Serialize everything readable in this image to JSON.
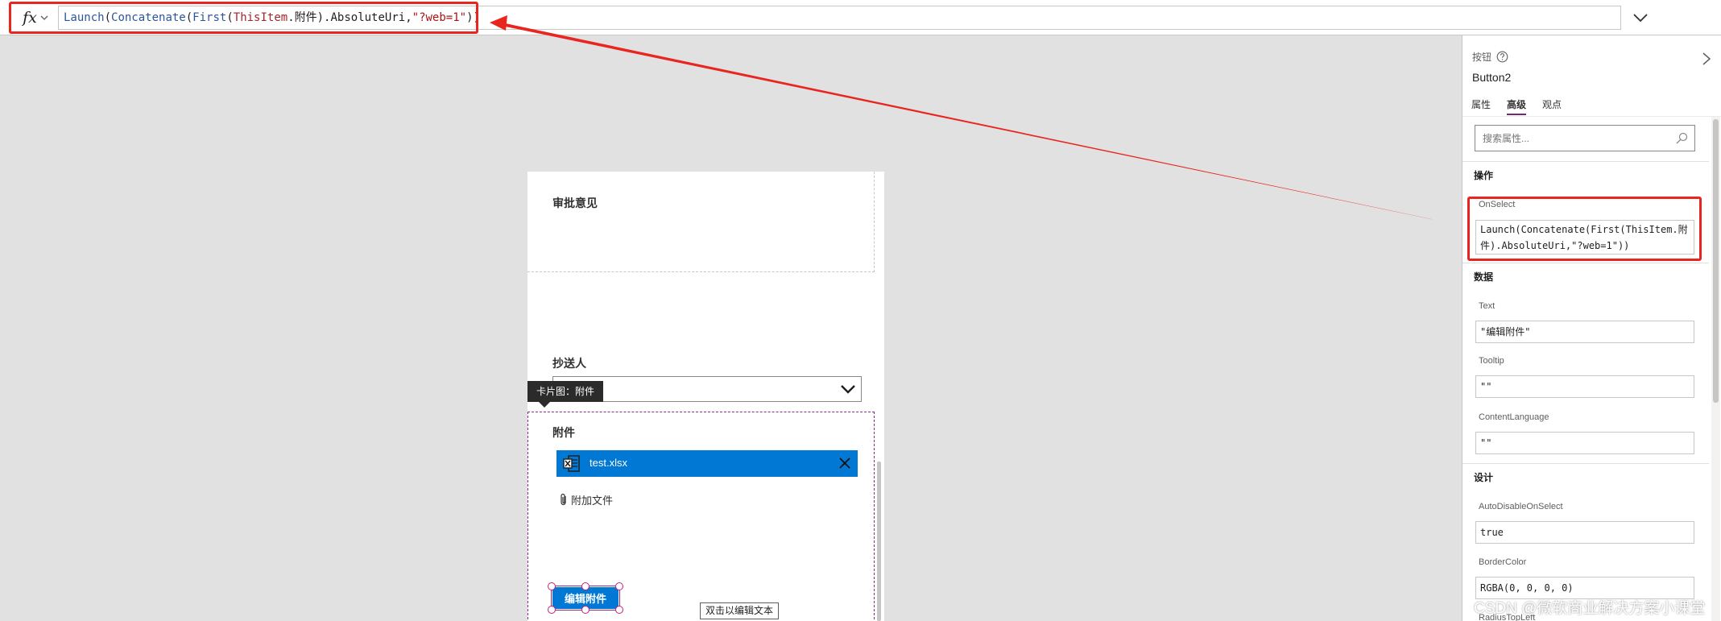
{
  "formula_bar": {
    "fx_label": "fx",
    "formula": {
      "t1": "Launch",
      "t2": "(",
      "t3": "Concatenate",
      "t4": "(",
      "t5": "First",
      "t6": "(",
      "t7": "ThisItem",
      "t8": ".附件).AbsoluteUri,",
      "t9": "\"?web=1\"",
      "t10": "))"
    }
  },
  "form": {
    "approval_label": "审批意见",
    "cc_label": "抄送人",
    "card_tooltip": "卡片图：附件",
    "attachment_label": "附件",
    "attachment_file": "test.xlsx",
    "attach_file_label": "附加文件",
    "edit_button_label": "编辑附件",
    "canvas_hint": "双击以编辑文本"
  },
  "panel": {
    "control_type": "按钮",
    "control_name": "Button2",
    "tabs": [
      "属性",
      "高级",
      "观点"
    ],
    "search_placeholder": "搜索属性...",
    "sections": {
      "action": "操作",
      "data": "数据",
      "design": "设计"
    },
    "props": {
      "onselect_label": "OnSelect",
      "onselect_value": "Launch(Concatenate(First(ThisItem.附件).AbsoluteUri,\"?web=1\"))",
      "text_label": "Text",
      "text_value": "\"编辑附件\"",
      "tooltip_label": "Tooltip",
      "tooltip_value": "\"\"",
      "contentlanguage_label": "ContentLanguage",
      "contentlanguage_value": "\"\"",
      "autodisable_label": "AutoDisableOnSelect",
      "autodisable_value": "true",
      "bordercolor_label": "BorderColor",
      "bordercolor_value": "RGBA(0, 0, 0, 0)",
      "radius_label": "RadiusTopLeft"
    }
  },
  "watermark": "CSDN @微软商业解决方案小课堂",
  "colors": {
    "accent": "#0078d4",
    "highlight": "#e8251e",
    "tab_underline": "#742774"
  }
}
